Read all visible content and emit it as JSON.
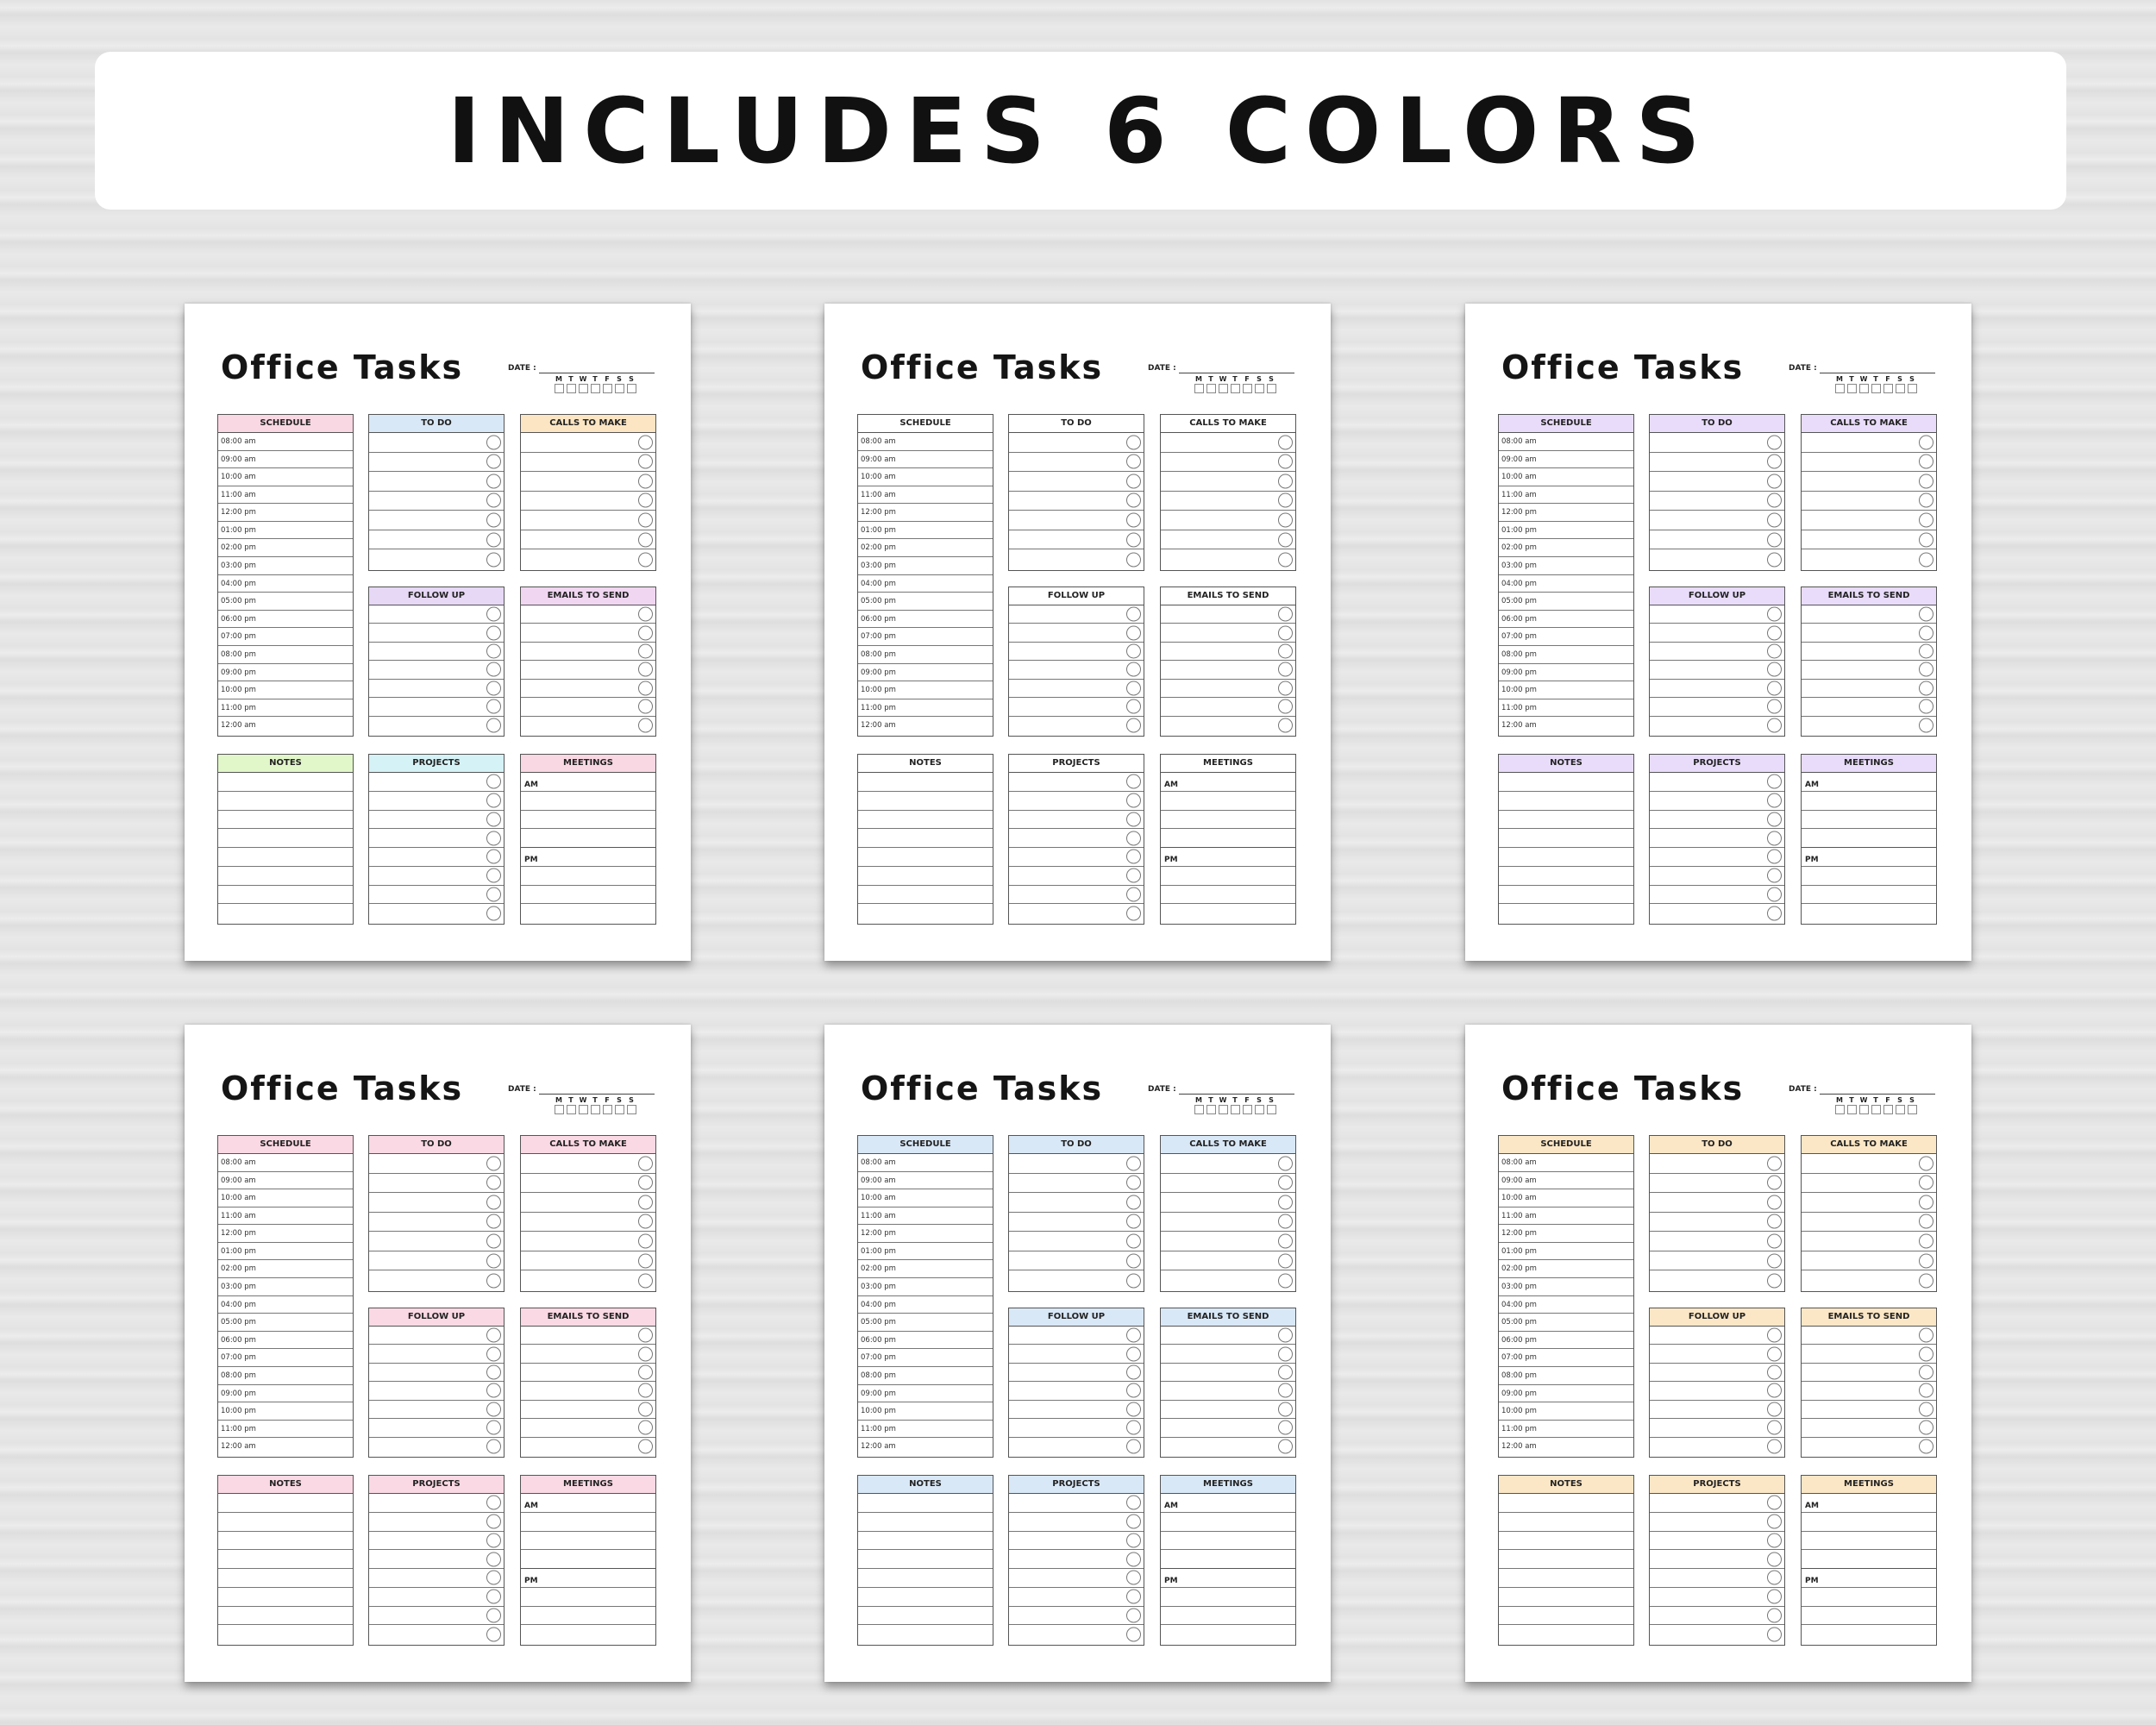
{
  "banner": {
    "title": "INCLUDES 6 COLORS"
  },
  "sheet": {
    "title": "Office Tasks",
    "date_label": "DATE :",
    "days": [
      "M",
      "T",
      "W",
      "T",
      "F",
      "S",
      "S"
    ],
    "schedule_label": "SCHEDULE",
    "times": [
      "08:00 am",
      "09:00 am",
      "10:00 am",
      "11:00 am",
      "12:00 pm",
      "01:00 pm",
      "02:00 pm",
      "03:00 pm",
      "04:00 pm",
      "05:00 pm",
      "06:00 pm",
      "07:00 pm",
      "08:00 pm",
      "09:00 pm",
      "10:00 pm",
      "11:00 pm",
      "12:00 am"
    ],
    "todo_label": "TO DO",
    "calls_label": "CALLS TO MAKE",
    "followup_label": "FOLLOW UP",
    "emails_label": "EMAILS TO SEND",
    "notes_label": "NOTES",
    "projects_label": "PROJECTS",
    "meetings_label": "MEETINGS",
    "am_label": "AM",
    "pm_label": "PM"
  },
  "variants": [
    {
      "name": "multicolor",
      "schedule": "#f9d7e3",
      "todo": "#d9e8f7",
      "calls": "#fbe5c2",
      "followup": "#e7d8f6",
      "emails": "#f1d6f1",
      "notes": "#e1f7c9",
      "projects": "#d5f2f6",
      "meetings": "#f9d7e3"
    },
    {
      "name": "white",
      "schedule": "#ffffff",
      "todo": "#ffffff",
      "calls": "#ffffff",
      "followup": "#ffffff",
      "emails": "#ffffff",
      "notes": "#ffffff",
      "projects": "#ffffff",
      "meetings": "#ffffff"
    },
    {
      "name": "lavender",
      "schedule": "#e9dcfb",
      "todo": "#e9dcfb",
      "calls": "#e9dcfb",
      "followup": "#e9dcfb",
      "emails": "#e9dcfb",
      "notes": "#e9dcfb",
      "projects": "#e9dcfb",
      "meetings": "#e9dcfb"
    },
    {
      "name": "pink",
      "schedule": "#fad9e4",
      "todo": "#fad9e4",
      "calls": "#fad9e4",
      "followup": "#fad9e4",
      "emails": "#fad9e4",
      "notes": "#fad9e4",
      "projects": "#fad9e4",
      "meetings": "#fad9e4"
    },
    {
      "name": "blue",
      "schedule": "#d9e8f7",
      "todo": "#d9e8f7",
      "calls": "#d9e8f7",
      "followup": "#d9e8f7",
      "emails": "#d9e8f7",
      "notes": "#d9e8f7",
      "projects": "#d9e8f7",
      "meetings": "#d9e8f7"
    },
    {
      "name": "peach",
      "schedule": "#fbe7c6",
      "todo": "#fbe7c6",
      "calls": "#fbe7c6",
      "followup": "#fbe7c6",
      "emails": "#fbe7c6",
      "notes": "#fbe7c6",
      "projects": "#fbe7c6",
      "meetings": "#fbe7c6"
    }
  ]
}
